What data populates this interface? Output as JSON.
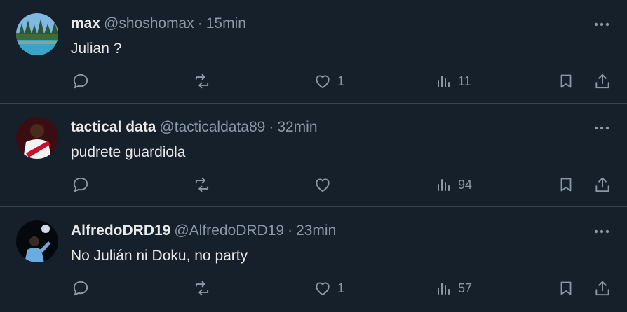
{
  "tweets": [
    {
      "name": "max",
      "handle": "@shoshomax",
      "separator": "·",
      "time": "15min",
      "text": "Julian ?",
      "likes": "1",
      "views": "11",
      "avatar_icon": "lake-landscape-avatar"
    },
    {
      "name": "tactical data",
      "handle": "@tacticaldata89",
      "separator": "·",
      "time": "32min",
      "text": "pudrete guardiola",
      "likes": "",
      "views": "94",
      "avatar_icon": "player-red-white-shirt-avatar"
    },
    {
      "name": "AlfredoDRD19",
      "handle": "@AlfredoDRD19",
      "separator": "·",
      "time": "23min",
      "text": "No Julián ni Doku, no party",
      "likes": "1",
      "views": "57",
      "avatar_icon": "player-sky-blue-shirt-avatar"
    }
  ],
  "icons": {
    "reply": "reply-icon",
    "retweet": "retweet-icon",
    "like": "heart-icon",
    "views": "views-chart-icon",
    "bookmark": "bookmark-icon",
    "share": "share-icon",
    "more": "more-dots-icon"
  },
  "colors": {
    "background": "#15202b",
    "divider": "#38444d",
    "text_primary": "#e7e9ea",
    "text_secondary": "#8b98a5"
  }
}
